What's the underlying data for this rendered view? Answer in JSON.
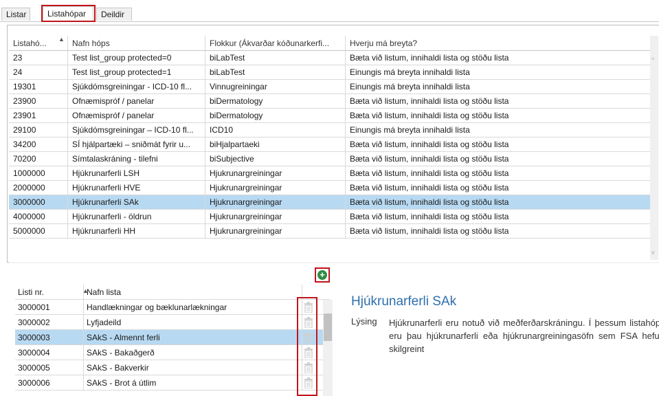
{
  "tabs": [
    {
      "label": "Listar"
    },
    {
      "label": "Listahópar"
    },
    {
      "label": "Deildir"
    }
  ],
  "groups_table": {
    "columns": [
      "Listahó...",
      "Nafn hóps",
      "Flokkur (Ákvarðar kóðunarkerfi...",
      "Hverju má breyta?"
    ],
    "rows": [
      {
        "id": "23",
        "name": "Test list_group protected=0",
        "category": "biLabTest",
        "editable": "Bæta við listum, innihaldi lista og stöðu lista"
      },
      {
        "id": "24",
        "name": "Test list_group protected=1",
        "category": "biLabTest",
        "editable": "Einungis má breyta innihaldi lista"
      },
      {
        "id": "19301",
        "name": "Sjúkdómsgreiningar - ICD-10 fl...",
        "category": "Vinnugreiningar",
        "editable": "Einungis má breyta innihaldi lista"
      },
      {
        "id": "23900",
        "name": "Ofnæmispróf / panelar",
        "category": "biDermatology",
        "editable": "Bæta við listum, innihaldi lista og stöðu lista"
      },
      {
        "id": "23901",
        "name": "Ofnæmispróf / panelar",
        "category": "biDermatology",
        "editable": "Bæta við listum, innihaldi lista og stöðu lista"
      },
      {
        "id": "29100",
        "name": "Sjúkdómsgreiningar – ICD-10 fl...",
        "category": "ICD10",
        "editable": "Einungis má breyta innihaldi lista"
      },
      {
        "id": "34200",
        "name": "SÍ hjálpartæki – sniðmát fyrir u...",
        "category": "biHjalpartaeki",
        "editable": "Bæta við listum, innihaldi lista og stöðu lista"
      },
      {
        "id": "70200",
        "name": "Símtalaskráning - tilefni",
        "category": "biSubjective",
        "editable": "Bæta við listum, innihaldi lista og stöðu lista"
      },
      {
        "id": "1000000",
        "name": "Hjúkrunarferli LSH",
        "category": "Hjukrunargreiningar",
        "editable": "Bæta við listum, innihaldi lista og stöðu lista"
      },
      {
        "id": "2000000",
        "name": "Hjúkrunarferli HVE",
        "category": "Hjukrunargreiningar",
        "editable": "Bæta við listum, innihaldi lista og stöðu lista"
      },
      {
        "id": "3000000",
        "name": "Hjúkrunarferli SAk",
        "category": "Hjukrunargreiningar",
        "editable": "Bæta við listum, innihaldi lista og stöðu lista"
      },
      {
        "id": "4000000",
        "name": "Hjúkrunarferli - öldrun",
        "category": "Hjukrunargreiningar",
        "editable": "Bæta við listum, innihaldi lista og stöðu lista"
      },
      {
        "id": "5000000",
        "name": "Hjúkrunarferli HH",
        "category": "Hjukrunargreiningar",
        "editable": "Bæta við listum, innihaldi lista og stöðu lista"
      }
    ]
  },
  "lists_table": {
    "columns": [
      "Listi nr.",
      "Nafn lista"
    ],
    "rows": [
      {
        "id": "3000001",
        "name": "Handlækningar og bæklunarlækningar"
      },
      {
        "id": "3000002",
        "name": "Lyfjadeild"
      },
      {
        "id": "3000003",
        "name": "SAkS - Almennt ferli"
      },
      {
        "id": "3000004",
        "name": "SAkS - Bakaðgerð"
      },
      {
        "id": "3000005",
        "name": "SAkS - Bakverkir"
      },
      {
        "id": "3000006",
        "name": "SAkS - Brot á útlim"
      }
    ]
  },
  "detail": {
    "title": "Hjúkrunarferli SAk",
    "description_label": "Lýsing",
    "description": "Hjúkrunarferli eru notuð við meðferðarskráningu. Í þessum listahópi eru þau hjúkrunarferli eða hjúkrunargreiningasöfn sem FSA hefur skilgreint"
  },
  "colors": {
    "selected_row": "#b8d9f2",
    "highlight_border": "#c0141b",
    "title_blue": "#2f6fad",
    "add_green": "#2e8b45"
  },
  "icons": {
    "add": "plus-circle-icon",
    "delete": "trash-icon",
    "sort": "sort-ascending-icon"
  }
}
